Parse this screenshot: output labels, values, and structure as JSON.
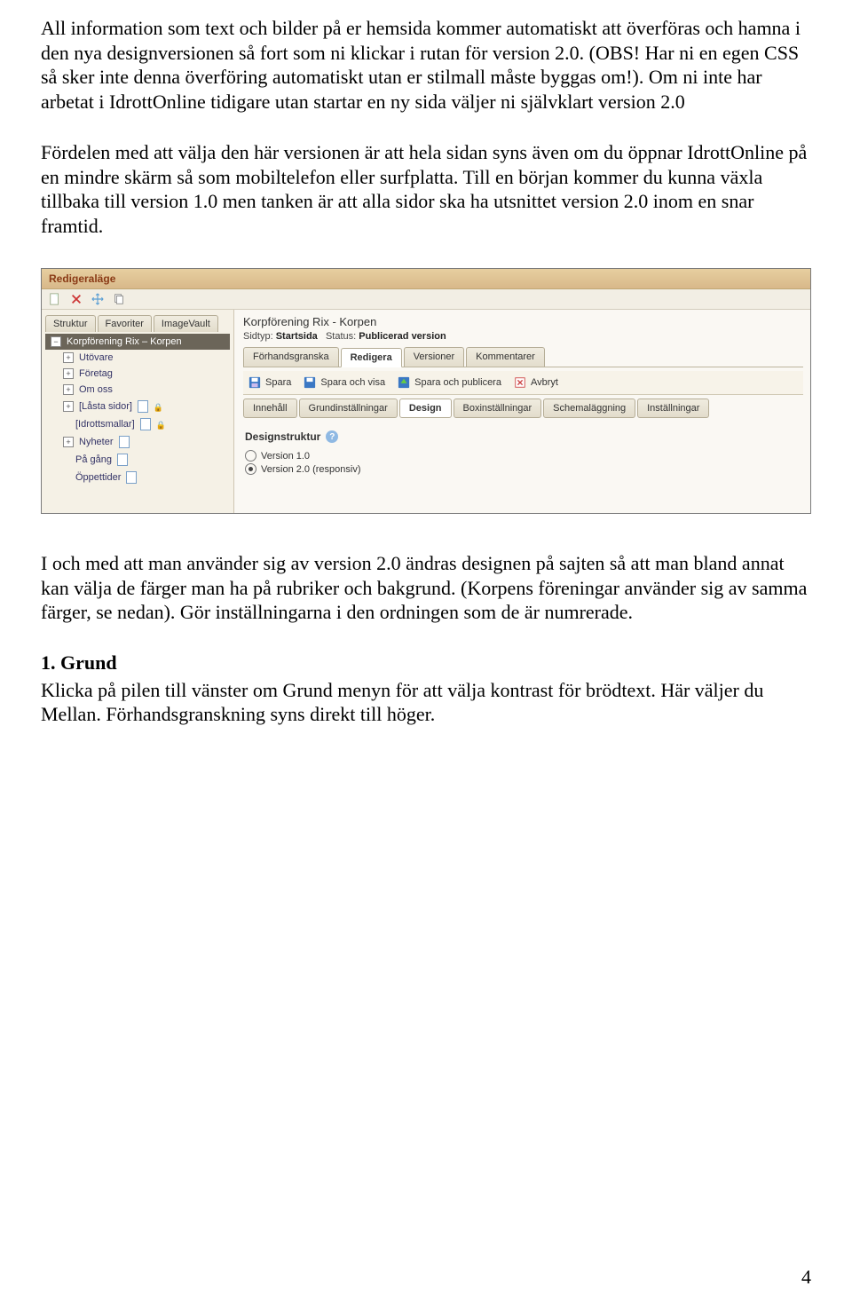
{
  "paragraphs": {
    "p1": "All information som text och bilder på er hemsida kommer automatiskt att överföras och hamna i den nya designversionen så fort som ni klickar i rutan för version 2.0. (OBS! Har ni en egen CSS så sker inte denna överföring automatiskt utan er stilmall måste byggas om!). Om ni inte har arbetat i IdrottOnline tidigare utan startar en ny sida väljer ni självklart version 2.0",
    "p2": "Fördelen med att välja den här versionen är att hela sidan syns även om du öppnar IdrottOnline på en mindre skärm så som mobiltelefon eller surfplatta. Till en början kommer du kunna växla tillbaka till version 1.0 men tanken är att alla sidor ska ha utsnittet version 2.0 inom en snar framtid.",
    "p3": "I och med att man använder sig av version 2.0 ändras designen på sajten så att man bland annat kan välja de färger man ha på rubriker och bakgrund. (Korpens föreningar använder sig av samma färger, se nedan). Gör inställningarna i den ordningen som de är numrerade.",
    "h_grund": "1. Grund",
    "p4": "Klicka på pilen till vänster om Grund menyn för att välja kontrast för brödtext. Här väljer du Mellan. Förhandsgranskning syns direkt till höger."
  },
  "page_number": "4",
  "editor": {
    "header": "Redigeraläge",
    "sidetabs": [
      "Struktur",
      "Favoriter",
      "ImageVault"
    ],
    "tree_root": "Korpförening Rix – Korpen",
    "tree": [
      "Utövare",
      "Företag",
      "Om oss",
      "[Låsta sidor]",
      "[Idrottsmallar]",
      "Nyheter",
      "På gång",
      "Öppettider"
    ],
    "page_title": "Korpförening Rix - Korpen",
    "sidtyp_label": "Sidtyp:",
    "sidtyp_value": "Startsida",
    "status_label": "Status:",
    "status_value": "Publicerad version",
    "tabs": [
      "Förhandsgranska",
      "Redigera",
      "Versioner",
      "Kommentarer"
    ],
    "save": {
      "spara": "Spara",
      "visa": "Spara och visa",
      "publ": "Spara och publicera",
      "avbryt": "Avbryt"
    },
    "subtabs": [
      "Innehåll",
      "Grundinställningar",
      "Design",
      "Boxinställningar",
      "Schemaläggning",
      "Inställningar"
    ],
    "design_label": "Designstruktur",
    "radio1": "Version 1.0",
    "radio2": "Version 2.0 (responsiv)"
  }
}
